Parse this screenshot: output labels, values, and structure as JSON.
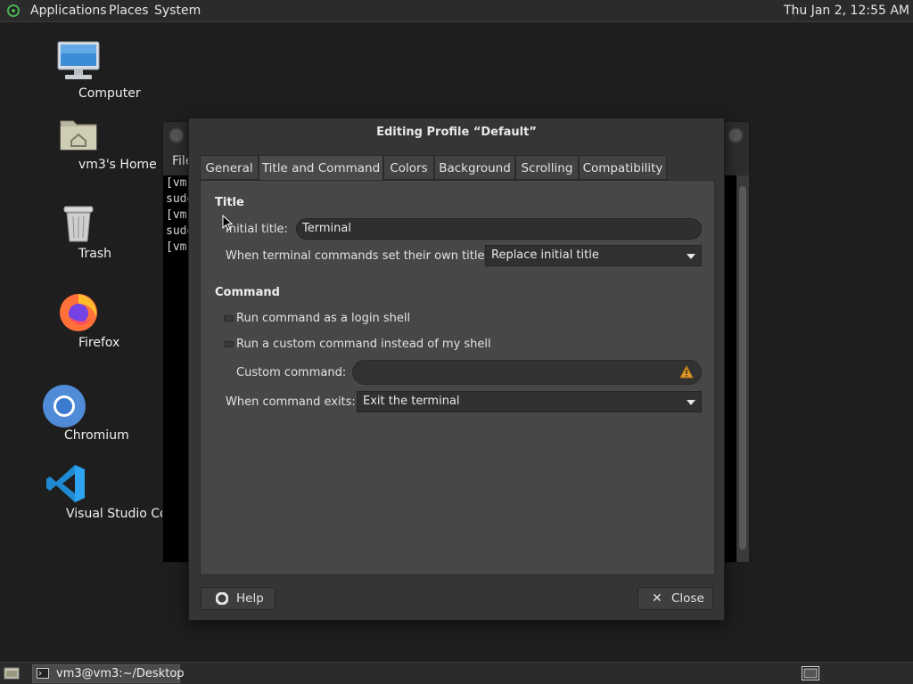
{
  "top_panel": {
    "menus": [
      "Applications",
      "Places",
      "System"
    ],
    "clock": "Thu Jan  2, 12:55 AM"
  },
  "desktop_icons": [
    {
      "label": "Computer",
      "icon": "computer-icon"
    },
    {
      "label": "vm3's Home",
      "icon": "home-folder-icon"
    },
    {
      "label": "Trash",
      "icon": "trash-icon"
    },
    {
      "label": "Firefox",
      "icon": "firefox-icon"
    },
    {
      "label": "Chromium",
      "icon": "chromium-icon"
    },
    {
      "label": "Visual Studio Code",
      "icon": "vscode-icon"
    }
  ],
  "terminal": {
    "menu_file": "File",
    "lines": [
      "[vm",
      "sudo",
      "[vm",
      "sudo",
      "[vm"
    ]
  },
  "dialog": {
    "title": "Editing Profile “Default”",
    "tabs": [
      "General",
      "Title and Command",
      "Colors",
      "Background",
      "Scrolling",
      "Compatibility"
    ],
    "active_tab": "Title and Command",
    "title_section": {
      "heading": "Title",
      "initial_title_label": "Initial title:",
      "initial_title_value": "Terminal",
      "own_titles_label": "When terminal commands set their own titles:",
      "own_titles_value": "Replace initial title"
    },
    "command_section": {
      "heading": "Command",
      "login_shell_label": "Run command as a login shell",
      "login_shell_checked": false,
      "custom_command_check_label": "Run a custom command instead of my shell",
      "custom_command_checked": false,
      "custom_command_label": "Custom command:",
      "custom_command_value": "",
      "exit_label": "When command exits:",
      "exit_value": "Exit the terminal"
    },
    "buttons": {
      "help": "Help",
      "close": "Close"
    }
  },
  "bottom_panel": {
    "task_label": "vm3@vm3:~/Desktop"
  },
  "colors": {
    "desktop_bg": "#1e1e1e",
    "panel_bg": "#2b2b2b",
    "dialog_bg": "#353535",
    "warning": "#f5a623"
  }
}
